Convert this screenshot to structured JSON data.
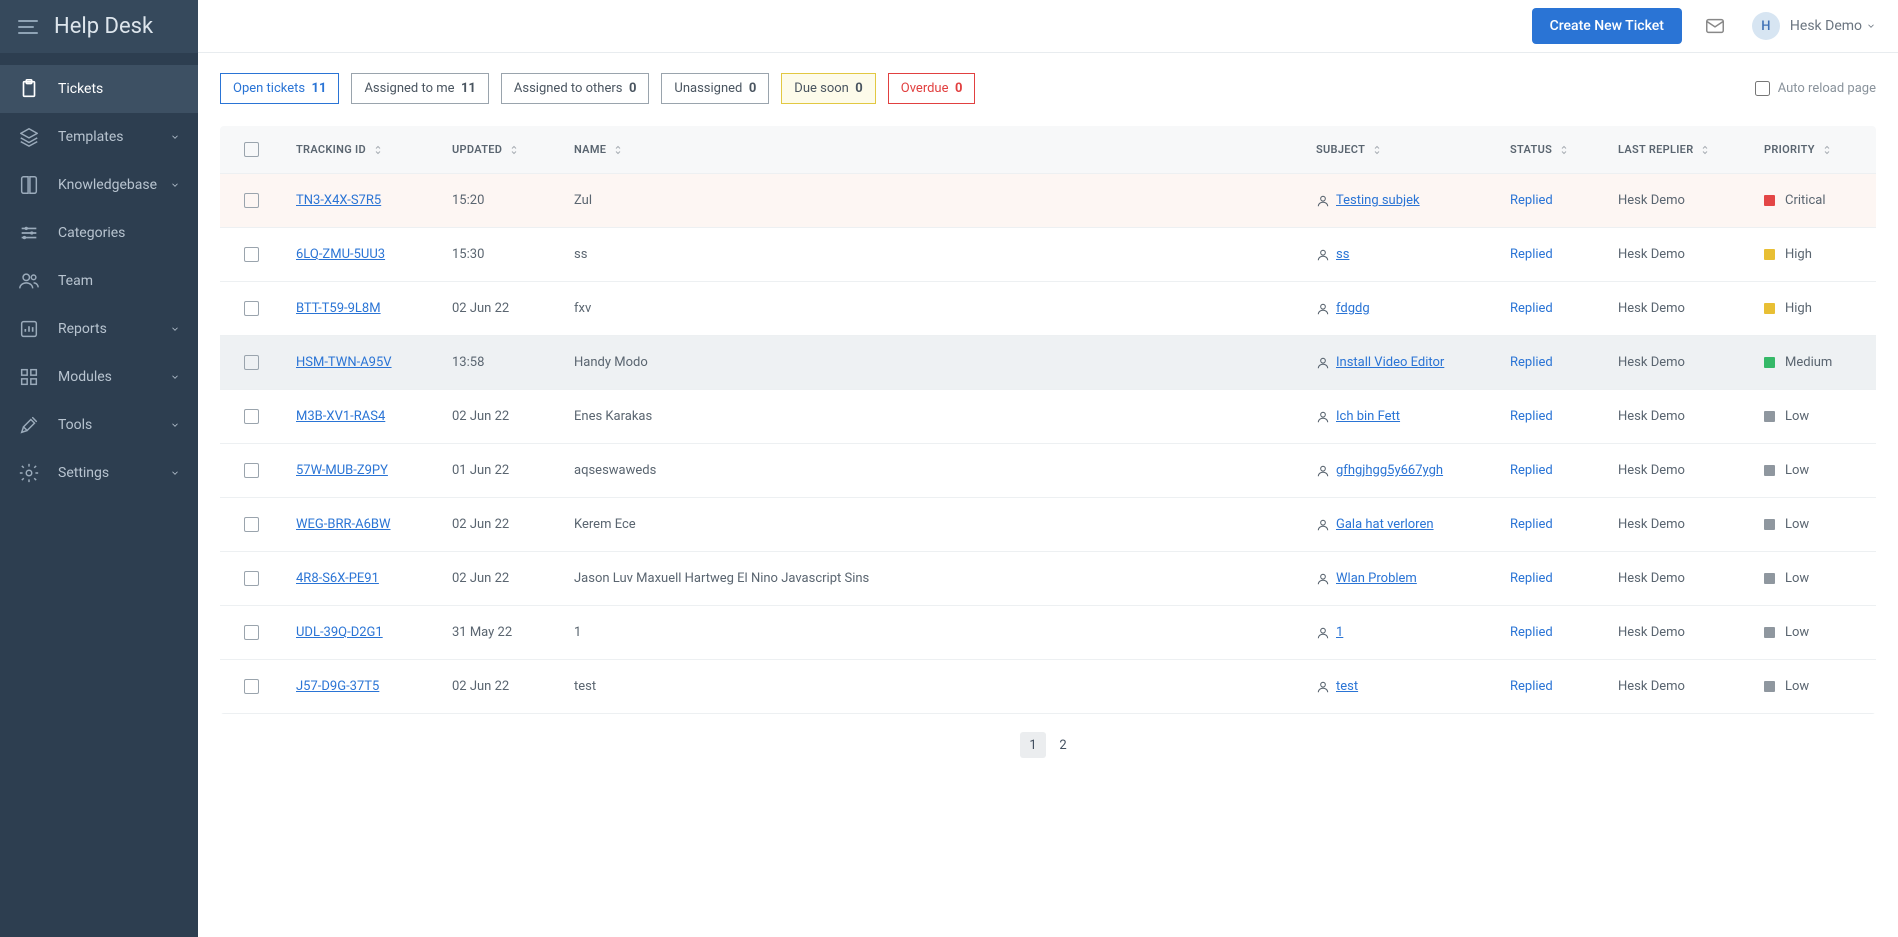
{
  "brand": "Help Desk",
  "nav": [
    {
      "label": "Tickets",
      "icon": "clipboard",
      "chev": false,
      "active": true
    },
    {
      "label": "Templates",
      "icon": "layers",
      "chev": true
    },
    {
      "label": "Knowledgebase",
      "icon": "book",
      "chev": true
    },
    {
      "label": "Categories",
      "icon": "sliders",
      "chev": false
    },
    {
      "label": "Team",
      "icon": "users",
      "chev": false
    },
    {
      "label": "Reports",
      "icon": "chart",
      "chev": true
    },
    {
      "label": "Modules",
      "icon": "grid",
      "chev": true
    },
    {
      "label": "Tools",
      "icon": "tools",
      "chev": true
    },
    {
      "label": "Settings",
      "icon": "gear",
      "chev": true
    }
  ],
  "topbar": {
    "create": "Create New Ticket",
    "user_initial": "H",
    "user_name": "Hesk Demo"
  },
  "filters": [
    {
      "label": "Open tickets",
      "count": "11",
      "cls": "active"
    },
    {
      "label": "Assigned to me",
      "count": "11",
      "cls": ""
    },
    {
      "label": "Assigned to others",
      "count": "0",
      "cls": ""
    },
    {
      "label": "Unassigned",
      "count": "0",
      "cls": ""
    },
    {
      "label": "Due soon",
      "count": "0",
      "cls": "due"
    },
    {
      "label": "Overdue",
      "count": "0",
      "cls": "overdue"
    }
  ],
  "auto_reload": "Auto reload page",
  "columns": {
    "tracking": "Tracking ID",
    "updated": "Updated",
    "name": "Name",
    "subject": "Subject",
    "status": "Status",
    "replier": "Last Replier",
    "priority": "Priority"
  },
  "rows": [
    {
      "track": "TN3-X4X-S7R5",
      "updated": "15:20",
      "name": "Zul",
      "subject": "Testing subjek",
      "status": "Replied",
      "replier": "Hesk Demo",
      "prio": "Critical",
      "prioCls": "critical",
      "hl": true
    },
    {
      "track": "6LQ-ZMU-5UU3",
      "updated": "15:30",
      "name": "ss",
      "subject": "ss",
      "status": "Replied",
      "replier": "Hesk Demo",
      "prio": "High",
      "prioCls": "high"
    },
    {
      "track": "BTT-T59-9L8M",
      "updated": "02 Jun 22",
      "name": "fxv",
      "subject": "fdgdg",
      "status": "Replied",
      "replier": "Hesk Demo",
      "prio": "High",
      "prioCls": "high"
    },
    {
      "track": "HSM-TWN-A95V",
      "updated": "13:58",
      "name": "Handy Modo",
      "subject": "Install Video Editor",
      "status": "Replied",
      "replier": "Hesk Demo",
      "prio": "Medium",
      "prioCls": "medium",
      "sel": true
    },
    {
      "track": "M3B-XV1-RAS4",
      "updated": "02 Jun 22",
      "name": "Enes Karakas",
      "subject": "Ich bin Fett",
      "status": "Replied",
      "replier": "Hesk Demo",
      "prio": "Low",
      "prioCls": "low"
    },
    {
      "track": "57W-MUB-Z9PY",
      "updated": "01 Jun 22",
      "name": "aqseswaweds",
      "subject": "gfhgjhgg5y667ygh",
      "status": "Replied",
      "replier": "Hesk Demo",
      "prio": "Low",
      "prioCls": "low"
    },
    {
      "track": "WEG-BRR-A6BW",
      "updated": "02 Jun 22",
      "name": "Kerem Ece",
      "subject": "Gala hat verloren",
      "status": "Replied",
      "replier": "Hesk Demo",
      "prio": "Low",
      "prioCls": "low"
    },
    {
      "track": "4R8-S6X-PE91",
      "updated": "02 Jun 22",
      "name": "Jason Luv Maxuell Hartweg El Nino Javascript Sins",
      "subject": "Wlan Problem",
      "status": "Replied",
      "replier": "Hesk Demo",
      "prio": "Low",
      "prioCls": "low"
    },
    {
      "track": "UDL-39Q-D2G1",
      "updated": "31 May 22",
      "name": "1",
      "subject": "1",
      "status": "Replied",
      "replier": "Hesk Demo",
      "prio": "Low",
      "prioCls": "low"
    },
    {
      "track": "J57-D9G-37T5",
      "updated": "02 Jun 22",
      "name": "test",
      "subject": "test",
      "status": "Replied",
      "replier": "Hesk Demo",
      "prio": "Low",
      "prioCls": "low"
    }
  ],
  "pages": [
    "1",
    "2"
  ]
}
